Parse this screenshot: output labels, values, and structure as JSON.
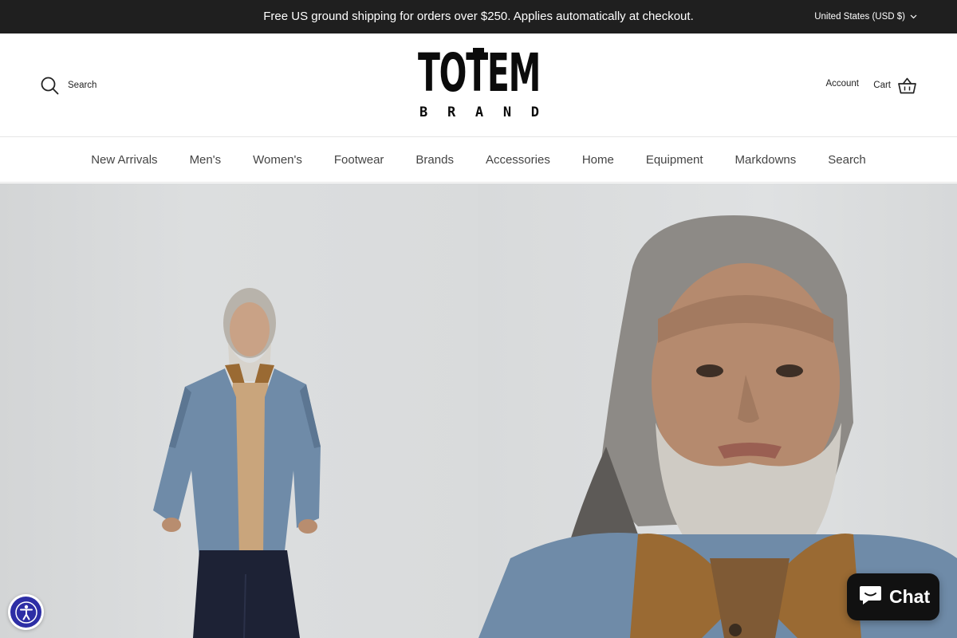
{
  "announcement": {
    "text": "Free US ground shipping for orders over $250. Applies automatically at checkout.",
    "locale": "United States (USD $)"
  },
  "header": {
    "search_label": "Search",
    "logo_letters": [
      "T",
      "O",
      "T",
      "E",
      "M"
    ],
    "logo_sub_letters": [
      "B",
      "R",
      "A",
      "N",
      "D"
    ],
    "account_label": "Account",
    "cart_label": "Cart"
  },
  "nav": {
    "items": [
      "New Arrivals",
      "Men's",
      "Women's",
      "Footwear",
      "Brands",
      "Accessories",
      "Home",
      "Equipment",
      "Markdowns",
      "Search"
    ]
  },
  "widgets": {
    "chat_label": "Chat"
  },
  "colors": {
    "announcement_bg": "#1f1f1f",
    "chat_bg": "#111111",
    "accessibility_bg": "#2d2ea5",
    "jacket_denim": "#6f8ba8",
    "collar_brown": "#9a6a33"
  },
  "icons": {
    "locale": "chevron-down-icon",
    "search": "search-icon",
    "cart": "basket-icon",
    "chat": "chat-bubble-icon",
    "accessibility": "accessibility-icon"
  }
}
